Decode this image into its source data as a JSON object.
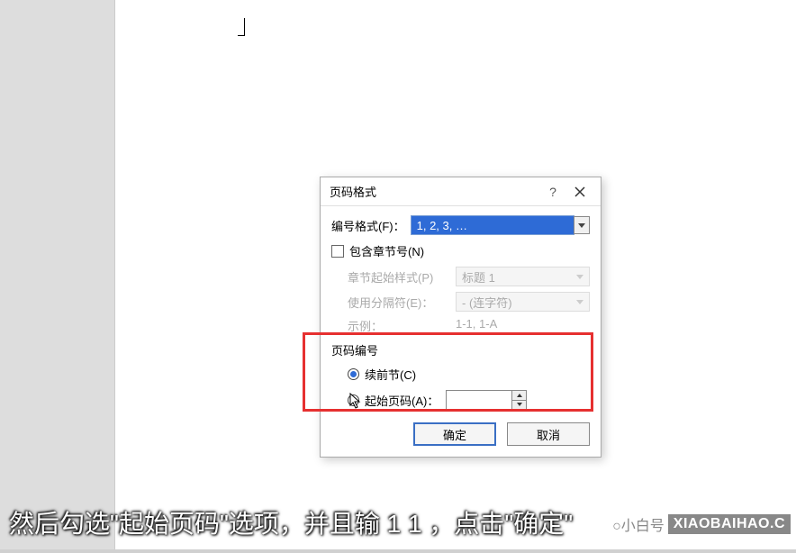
{
  "watermark": {
    "cn": "@小白号",
    "url": "XIAOBAIHAO.COM"
  },
  "dialog": {
    "title": "页码格式",
    "help": "?",
    "number_format_label": "编号格式(F)：",
    "number_format_value": "1, 2, 3, …",
    "include_chapter_label": "包含章节号(N)",
    "chapter_start_label": "章节起始样式(P)",
    "chapter_start_value": "标题 1",
    "separator_label": "使用分隔符(E)：",
    "separator_value": "-   (连字符)",
    "example_label": "示例：",
    "example_value": "1-1, 1-A",
    "pagenum_section": "页码编号",
    "continue_label": "续前节(C)",
    "start_at_label": "起始页码(A)：",
    "ok": "确定",
    "cancel": "取消"
  },
  "subtitle": "然后勾选\"起始页码\"选项，并且输 1 1 ，点击\"确定\"",
  "logo": {
    "cn": "○小白号",
    "url": "XIAOBAIHAO.C"
  }
}
